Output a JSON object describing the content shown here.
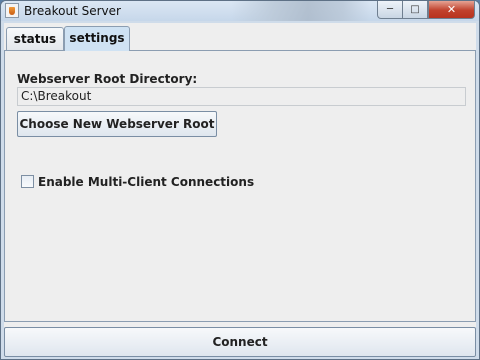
{
  "window": {
    "title": "Breakout Server",
    "icon": "java-coffee-cup-icon",
    "controls": {
      "minimize": "minimize-icon",
      "maximize": "maximize-icon",
      "close": "close-icon"
    }
  },
  "tabs": [
    {
      "label": "status",
      "selected": false
    },
    {
      "label": "settings",
      "selected": true
    }
  ],
  "settings": {
    "root_label": "Webserver Root Directory:",
    "root_value": "C:\\Breakout",
    "choose_button": "Choose New Webserver Root",
    "multi_client_label": "Enable Multi-Client Connections",
    "multi_client_checked": false
  },
  "footer": {
    "connect_button": "Connect"
  }
}
